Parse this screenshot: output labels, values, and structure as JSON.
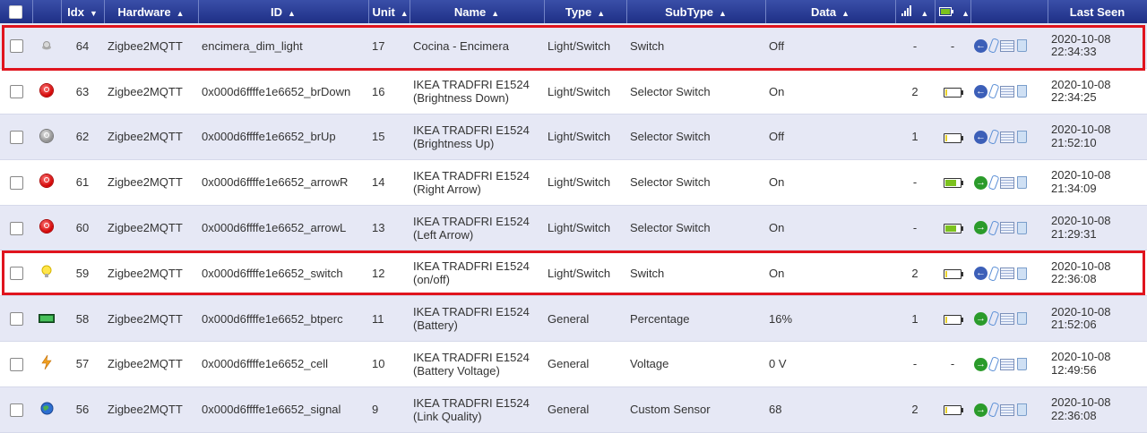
{
  "header": {
    "idx": "Idx",
    "hardware": "Hardware",
    "id": "ID",
    "unit": "Unit",
    "name": "Name",
    "type": "Type",
    "subtype": "SubType",
    "data": "Data",
    "last_seen": "Last Seen",
    "signal_icon": "signal-icon",
    "battery_icon": "battery-icon"
  },
  "rows": [
    {
      "idx": "64",
      "hardware": "Zigbee2MQTT",
      "id": "encimera_dim_light",
      "unit": "17",
      "name": "Cocina - Encimera",
      "type": "Light/Switch",
      "subtype": "Switch",
      "data": "Off",
      "signal": "-",
      "battery": "-",
      "last_seen": "2020-10-08 22:34:33",
      "icon": "dimmer-icon",
      "nav": "back",
      "battery_level": null
    },
    {
      "idx": "63",
      "hardware": "Zigbee2MQTT",
      "id": "0x000d6ffffe1e6652_brDown",
      "unit": "16",
      "name": "IKEA TRADFRI E1524 (Brightness Down)",
      "type": "Light/Switch",
      "subtype": "Selector Switch",
      "data": "On",
      "signal": "2",
      "battery": "",
      "last_seen": "2020-10-08 22:34:25",
      "icon": "power-on-icon",
      "nav": "back",
      "battery_level": 0.1
    },
    {
      "idx": "62",
      "hardware": "Zigbee2MQTT",
      "id": "0x000d6ffffe1e6652_brUp",
      "unit": "15",
      "name": "IKEA TRADFRI E1524 (Brightness Up)",
      "type": "Light/Switch",
      "subtype": "Selector Switch",
      "data": "Off",
      "signal": "1",
      "battery": "",
      "last_seen": "2020-10-08 21:52:10",
      "icon": "power-off-icon",
      "nav": "back",
      "battery_level": 0.1
    },
    {
      "idx": "61",
      "hardware": "Zigbee2MQTT",
      "id": "0x000d6ffffe1e6652_arrowR",
      "unit": "14",
      "name": "IKEA TRADFRI E1524 (Right Arrow)",
      "type": "Light/Switch",
      "subtype": "Selector Switch",
      "data": "On",
      "signal": "-",
      "battery": "",
      "last_seen": "2020-10-08 21:34:09",
      "icon": "power-on-icon",
      "nav": "forward",
      "battery_level": 0.85
    },
    {
      "idx": "60",
      "hardware": "Zigbee2MQTT",
      "id": "0x000d6ffffe1e6652_arrowL",
      "unit": "13",
      "name": "IKEA TRADFRI E1524 (Left Arrow)",
      "type": "Light/Switch",
      "subtype": "Selector Switch",
      "data": "On",
      "signal": "-",
      "battery": "",
      "last_seen": "2020-10-08 21:29:31",
      "icon": "power-on-icon",
      "nav": "forward",
      "battery_level": 0.85
    },
    {
      "idx": "59",
      "hardware": "Zigbee2MQTT",
      "id": "0x000d6ffffe1e6652_switch",
      "unit": "12",
      "name": "IKEA TRADFRI E1524 (on/off)",
      "type": "Light/Switch",
      "subtype": "Switch",
      "data": "On",
      "signal": "2",
      "battery": "",
      "last_seen": "2020-10-08 22:36:08",
      "icon": "lightbulb-icon",
      "nav": "back",
      "battery_level": 0.1
    },
    {
      "idx": "58",
      "hardware": "Zigbee2MQTT",
      "id": "0x000d6ffffe1e6652_btperc",
      "unit": "11",
      "name": "IKEA TRADFRI E1524 (Battery)",
      "type": "General",
      "subtype": "Percentage",
      "data": "16%",
      "signal": "1",
      "battery": "",
      "last_seen": "2020-10-08 21:52:06",
      "icon": "percentage-icon",
      "nav": "forward",
      "battery_level": 0.1
    },
    {
      "idx": "57",
      "hardware": "Zigbee2MQTT",
      "id": "0x000d6ffffe1e6652_cell",
      "unit": "10",
      "name": "IKEA TRADFRI E1524 (Battery Voltage)",
      "type": "General",
      "subtype": "Voltage",
      "data": "0 V",
      "signal": "-",
      "battery": "-",
      "last_seen": "2020-10-08 12:49:56",
      "icon": "voltage-icon",
      "nav": "forward",
      "battery_level": null
    },
    {
      "idx": "56",
      "hardware": "Zigbee2MQTT",
      "id": "0x000d6ffffe1e6652_signal",
      "unit": "9",
      "name": "IKEA TRADFRI E1524 (Link Quality)",
      "type": "General",
      "subtype": "Custom Sensor",
      "data": "68",
      "signal": "2",
      "battery": "",
      "last_seen": "2020-10-08 22:36:08",
      "icon": "globe-icon",
      "nav": "forward",
      "battery_level": 0.1
    }
  ],
  "colors": {
    "header_bg": "#1e2f86",
    "highlight": "#e0141e",
    "row_alt": "#e6e8f5",
    "battery_low": "#e8d02a",
    "battery_ok": "#7cc21e"
  }
}
